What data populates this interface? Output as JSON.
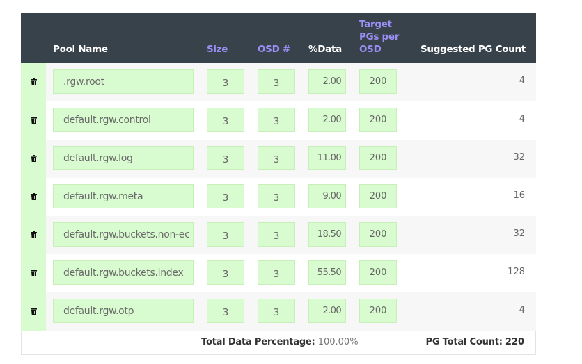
{
  "table": {
    "headers": {
      "pool_name": "Pool Name",
      "size": "Size",
      "osd": "OSD #",
      "data": "%Data",
      "target": [
        "Target",
        "PGs per",
        "OSD"
      ],
      "suggested": "Suggested PG Count"
    },
    "rows": [
      {
        "name": ".rgw.root",
        "size": "3",
        "osd": "3",
        "data": "2.00",
        "target": "200",
        "pg": "4"
      },
      {
        "name": "default.rgw.control",
        "size": "3",
        "osd": "3",
        "data": "2.00",
        "target": "200",
        "pg": "4"
      },
      {
        "name": "default.rgw.log",
        "size": "3",
        "osd": "3",
        "data": "11.00",
        "target": "200",
        "pg": "32"
      },
      {
        "name": "default.rgw.meta",
        "size": "3",
        "osd": "3",
        "data": "9.00",
        "target": "200",
        "pg": "16"
      },
      {
        "name": "default.rgw.buckets.non-ec",
        "size": "3",
        "osd": "3",
        "data": "18.50",
        "target": "200",
        "pg": "32"
      },
      {
        "name": "default.rgw.buckets.index",
        "size": "3",
        "osd": "3",
        "data": "55.50",
        "target": "200",
        "pg": "128"
      },
      {
        "name": "default.rgw.otp",
        "size": "3",
        "osd": "3",
        "data": "2.00",
        "target": "200",
        "pg": "4"
      }
    ],
    "delete_icon": "trash-icon"
  },
  "footer": {
    "total_data_label": "Total Data Percentage:",
    "total_data_value": "100.00%",
    "pg_total_label": "PG Total Count:",
    "pg_total_value": "220"
  },
  "colors": {
    "header_bg": "#38424a",
    "header_link": "#9b8ff5",
    "input_bg": "#d9fbd0",
    "row_alt": "#f7f7f7"
  }
}
